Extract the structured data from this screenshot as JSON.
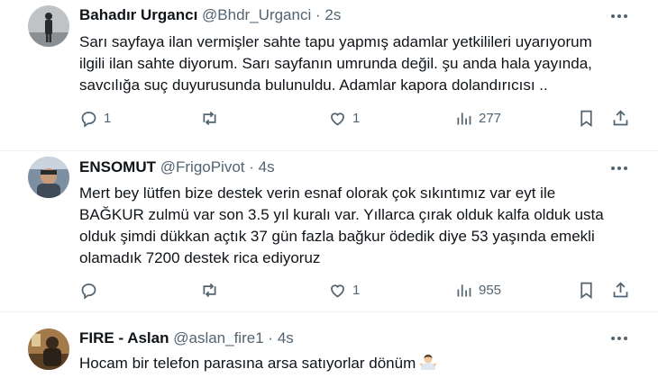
{
  "tweets": [
    {
      "name": "Bahadır Urgancı",
      "handle": "@Bhdr_Urganci",
      "dot": "·",
      "time": "2s",
      "text": "Sarı sayfaya ilan vermişler sahte tapu yapmış adamlar yetkilileri uyarıyorum\nilgili ilan sahte diyorum. Sarı sayfanın umrunda değil.  şu anda hala yayında,\nsavcılığa suç duyurusunda bulunuldu. Adamlar kapora dolandırıcısı ..",
      "replies": "1",
      "retweets": "",
      "likes": "1",
      "views": "277"
    },
    {
      "name": "ENSOMUT",
      "handle": "@FrigoPivot",
      "dot": "·",
      "time": "4s",
      "text": "Mert bey lütfen bize destek verin esnaf olorak çok sıkıntımız var eyt ile\nBAĞKUR zulmü var son 3.5 yıl kuralı var. Yıllarca çırak olduk kalfa olduk usta\nolduk şimdi dükkan açtık 37 gün fazla bağkur ödedik diye 53 yaşında emekli\nolamadık 7200 destek rica ediyoruz",
      "replies": "",
      "retweets": "",
      "likes": "1",
      "views": "955"
    },
    {
      "name": "FIRE - Aslan",
      "handle": "@aslan_fire1",
      "dot": "·",
      "time": "4s",
      "text": "Hocam bir telefon parasına arsa satıyorlar dönüm",
      "emoji": "man-shrugging-emoji"
    }
  ],
  "icons": [
    "more-icon",
    "reply-icon",
    "retweet-icon",
    "like-icon",
    "views-icon",
    "bookmark-icon",
    "share-icon"
  ],
  "colors": {
    "text": "#0f1419",
    "secondary": "#536471",
    "divider": "#eff3f4"
  }
}
